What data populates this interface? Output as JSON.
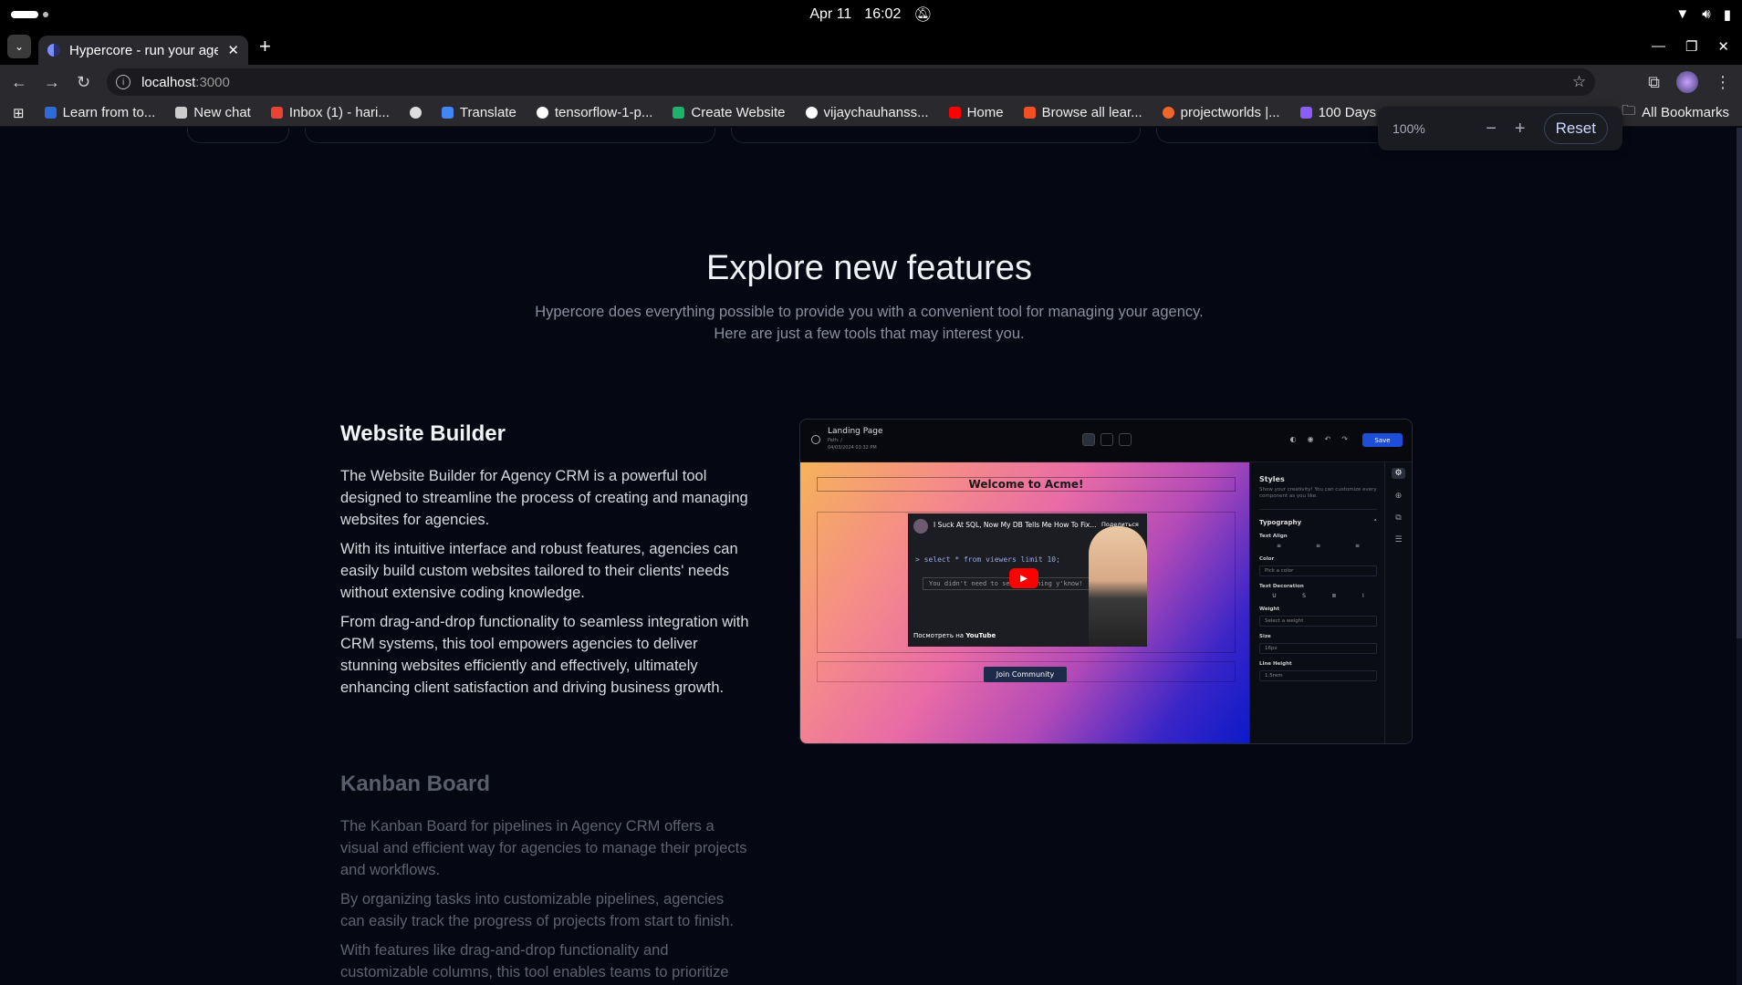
{
  "os": {
    "date": "Apr 11",
    "time": "16:02"
  },
  "browser": {
    "tab_title": "Hypercore - run your age",
    "url_host": "localhost",
    "url_port": ":3000",
    "bookmarks": [
      {
        "label": "Learn from to...",
        "color": "#2d6bd8"
      },
      {
        "label": "New chat",
        "color": "#cccccc"
      },
      {
        "label": "Inbox (1) - hari...",
        "color": "#ea4335"
      },
      {
        "label": "",
        "color": "#dddddd"
      },
      {
        "label": "Translate",
        "color": "#4285f4"
      },
      {
        "label": "tensorflow-1-p...",
        "color": "#ffffff"
      },
      {
        "label": "Create Website",
        "color": "#1db26b"
      },
      {
        "label": "vijaychauhanss...",
        "color": "#ffffff"
      },
      {
        "label": "Home",
        "color": "#ff0000"
      },
      {
        "label": "Browse all lear...",
        "color": "#f25022"
      },
      {
        "label": "projectworlds |...",
        "color": "#f06529"
      },
      {
        "label": "100 Days of DSA",
        "color": "#8b5cf6"
      }
    ],
    "all_bookmarks": "All Bookmarks",
    "zoom": {
      "level": "100%",
      "reset": "Reset"
    }
  },
  "hero": {
    "title": "Explore new features",
    "subtitle_line1": "Hypercore does everything possible to provide you with a convenient tool for managing your agency.",
    "subtitle_line2": "Here are just a few tools that may interest you."
  },
  "features": [
    {
      "title": "Website Builder",
      "paragraphs": [
        "The Website Builder for Agency CRM is a powerful tool designed to streamline the process of creating and managing websites for agencies.",
        "With its intuitive interface and robust features, agencies can easily build custom websites tailored to their clients' needs without extensive coding knowledge.",
        "From drag-and-drop functionality to seamless integration with CRM systems, this tool empowers agencies to deliver stunning websites efficiently and effectively, ultimately enhancing client satisfaction and driving business growth."
      ]
    },
    {
      "title": "Kanban Board",
      "paragraphs": [
        "The Kanban Board for pipelines in Agency CRM offers a visual and efficient way for agencies to manage their projects and workflows.",
        "By organizing tasks into customizable pipelines, agencies can easily track the progress of projects from start to finish.",
        "With features like drag-and-drop functionality and customizable columns, this tool enables teams to prioritize"
      ]
    }
  ],
  "builder_preview": {
    "page_name": "Landing Page",
    "path": "Path: /",
    "updated": "04/03/2024 03:32 PM",
    "save": "Save",
    "welcome": "Welcome to Acme!",
    "video_title": "I Suck At SQL, Now My DB Tells Me How To Fix...",
    "video_code": "> select * from viewers limit 10;",
    "video_code2": "You didn't need to se... rything y'know!",
    "video_share": "Поделиться",
    "video_watch": "Посмотреть на",
    "video_brand": "YouTube",
    "join": "Join Community",
    "panel": {
      "title": "Styles",
      "desc": "Show your creativity! You can customize every component as you like.",
      "section": "Typography",
      "text_align": "Text Align",
      "color": "Color",
      "color_placeholder": "Pick a color",
      "text_decoration": "Text Decoration",
      "weight": "Weight",
      "weight_placeholder": "Select a weight",
      "size": "Size",
      "size_value": "16px",
      "line_height": "Line Height",
      "line_height_value": "1.5rem"
    }
  }
}
